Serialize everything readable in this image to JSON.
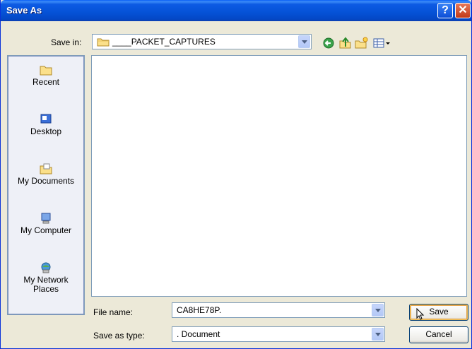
{
  "window": {
    "title": "Save As",
    "help_symbol": "?",
    "close_symbol": "✕"
  },
  "save_in": {
    "label": "Save in:",
    "value": "____PACKET_CAPTURES",
    "icon": "folder-icon"
  },
  "toolbar": {
    "icons": [
      "back-icon",
      "up-folder-icon",
      "new-folder-icon",
      "views-menu-icon"
    ]
  },
  "places": [
    {
      "label": "Recent",
      "icon": "recent-icon"
    },
    {
      "label": "Desktop",
      "icon": "desktop-icon"
    },
    {
      "label": "My Documents",
      "icon": "my-documents-icon"
    },
    {
      "label": "My Computer",
      "icon": "my-computer-icon"
    },
    {
      "label": "My Network Places",
      "label_line1": "My Network",
      "label_line2": "Places",
      "icon": "network-places-icon"
    }
  ],
  "file_name": {
    "label": "File name:",
    "value": "CA8HE78P."
  },
  "save_type": {
    "label": "Save as type:",
    "value": ". Document"
  },
  "buttons": {
    "save": "Save",
    "cancel": "Cancel"
  },
  "colors": {
    "title_bar": "#0552d6",
    "dialog_bg": "#ece9d8",
    "places_bg": "#eef0f7",
    "border": "#7f9db9"
  }
}
